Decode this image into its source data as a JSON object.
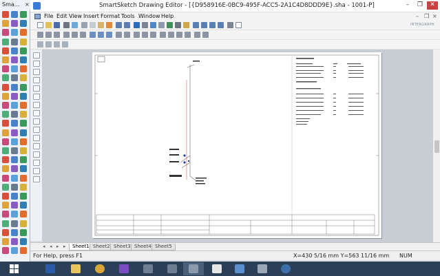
{
  "palette": {
    "title": "Sma..."
  },
  "window": {
    "title": "SmartSketch Drawing Editor - [{D958916E-0BC9-495F-ACC5-2A1C4D8DDD9E}.sha - 1001-P]",
    "minimize": "–",
    "restore": "❐",
    "close": "✕"
  },
  "menu": [
    "File",
    "Edit",
    "View",
    "Insert",
    "Format",
    "Tools",
    "Window",
    "Help"
  ],
  "brand": "INTERGRAPH",
  "tabs": [
    "Sheet1",
    "Sheet2",
    "Sheet3",
    "Sheet4",
    "Sheet5"
  ],
  "active_tab": "Sheet1",
  "status": {
    "help": "For Help, press F1",
    "coords": "X=430 5/16 mm  Y=563 11/16 mm",
    "num": "NUM"
  },
  "taskbar": {
    "items": [
      "start",
      "powershell",
      "file-explorer",
      "key-app",
      "visual-studio",
      "smartsketch-1",
      "smartsketch-2",
      "smartsketch-3",
      "document-app",
      "network-app",
      "snipping-tool",
      "fingerprint-app"
    ],
    "active": "smartsketch-3"
  },
  "colors": {
    "taskbar": "#2b3f57",
    "accent": "#1c6fd0",
    "drawing_line": "#555555",
    "drawing_red": "#c83a3a"
  }
}
